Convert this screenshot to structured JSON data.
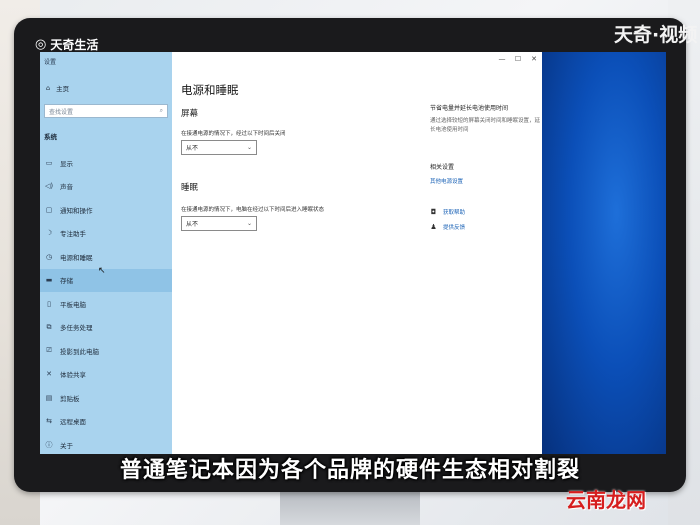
{
  "overlay": {
    "brand_left": "天奇生活",
    "brand_right": "天奇·视频",
    "subtitle": "普通笔记本因为各个品牌的硬件生态相对割裂",
    "watermark": "云南龙网"
  },
  "window": {
    "title": "设置",
    "controls": [
      "—",
      "☐",
      "✕"
    ]
  },
  "sidebar": {
    "home": "主页",
    "search_placeholder": "查找设置",
    "section": "系统",
    "items": [
      {
        "label": "显示",
        "icon": "display-icon"
      },
      {
        "label": "声音",
        "icon": "sound-icon"
      },
      {
        "label": "通知和操作",
        "icon": "notification-icon"
      },
      {
        "label": "专注助手",
        "icon": "moon-icon"
      },
      {
        "label": "电源和睡眠",
        "icon": "power-icon"
      },
      {
        "label": "存储",
        "icon": "storage-icon"
      },
      {
        "label": "平板电脑",
        "icon": "tablet-icon"
      },
      {
        "label": "多任务处理",
        "icon": "multitask-icon"
      },
      {
        "label": "投影到此电脑",
        "icon": "project-icon"
      },
      {
        "label": "体验共享",
        "icon": "share-icon"
      },
      {
        "label": "剪贴板",
        "icon": "clipboard-icon"
      },
      {
        "label": "远程桌面",
        "icon": "remote-icon"
      },
      {
        "label": "关于",
        "icon": "info-icon"
      }
    ],
    "selected_index": 5
  },
  "main": {
    "title": "电源和睡眠",
    "screen_heading": "屏幕",
    "screen_desc": "在接通电源的情况下，经过以下时间后关闭",
    "screen_value": "从不",
    "sleep_heading": "睡眠",
    "sleep_desc": "在接通电源的情况下，电脑在经过以下时间后进入睡眠状态",
    "sleep_value": "从不"
  },
  "related": {
    "tip_heading": "节省电量并延长电池使用时间",
    "tip_text": "通过选择较短的屏幕关闭时间和睡眠设置，延长电池使用时间",
    "related_heading": "相关设置",
    "other_power_link": "其他电源设置",
    "help_link": "获取帮助",
    "feedback_link": "提供反馈"
  },
  "colors": {
    "sidebar_bg": "#a9d3ee",
    "selected_bg": "#8fc3e6",
    "link": "#1a62b6",
    "watermark": "#d61e1e"
  }
}
